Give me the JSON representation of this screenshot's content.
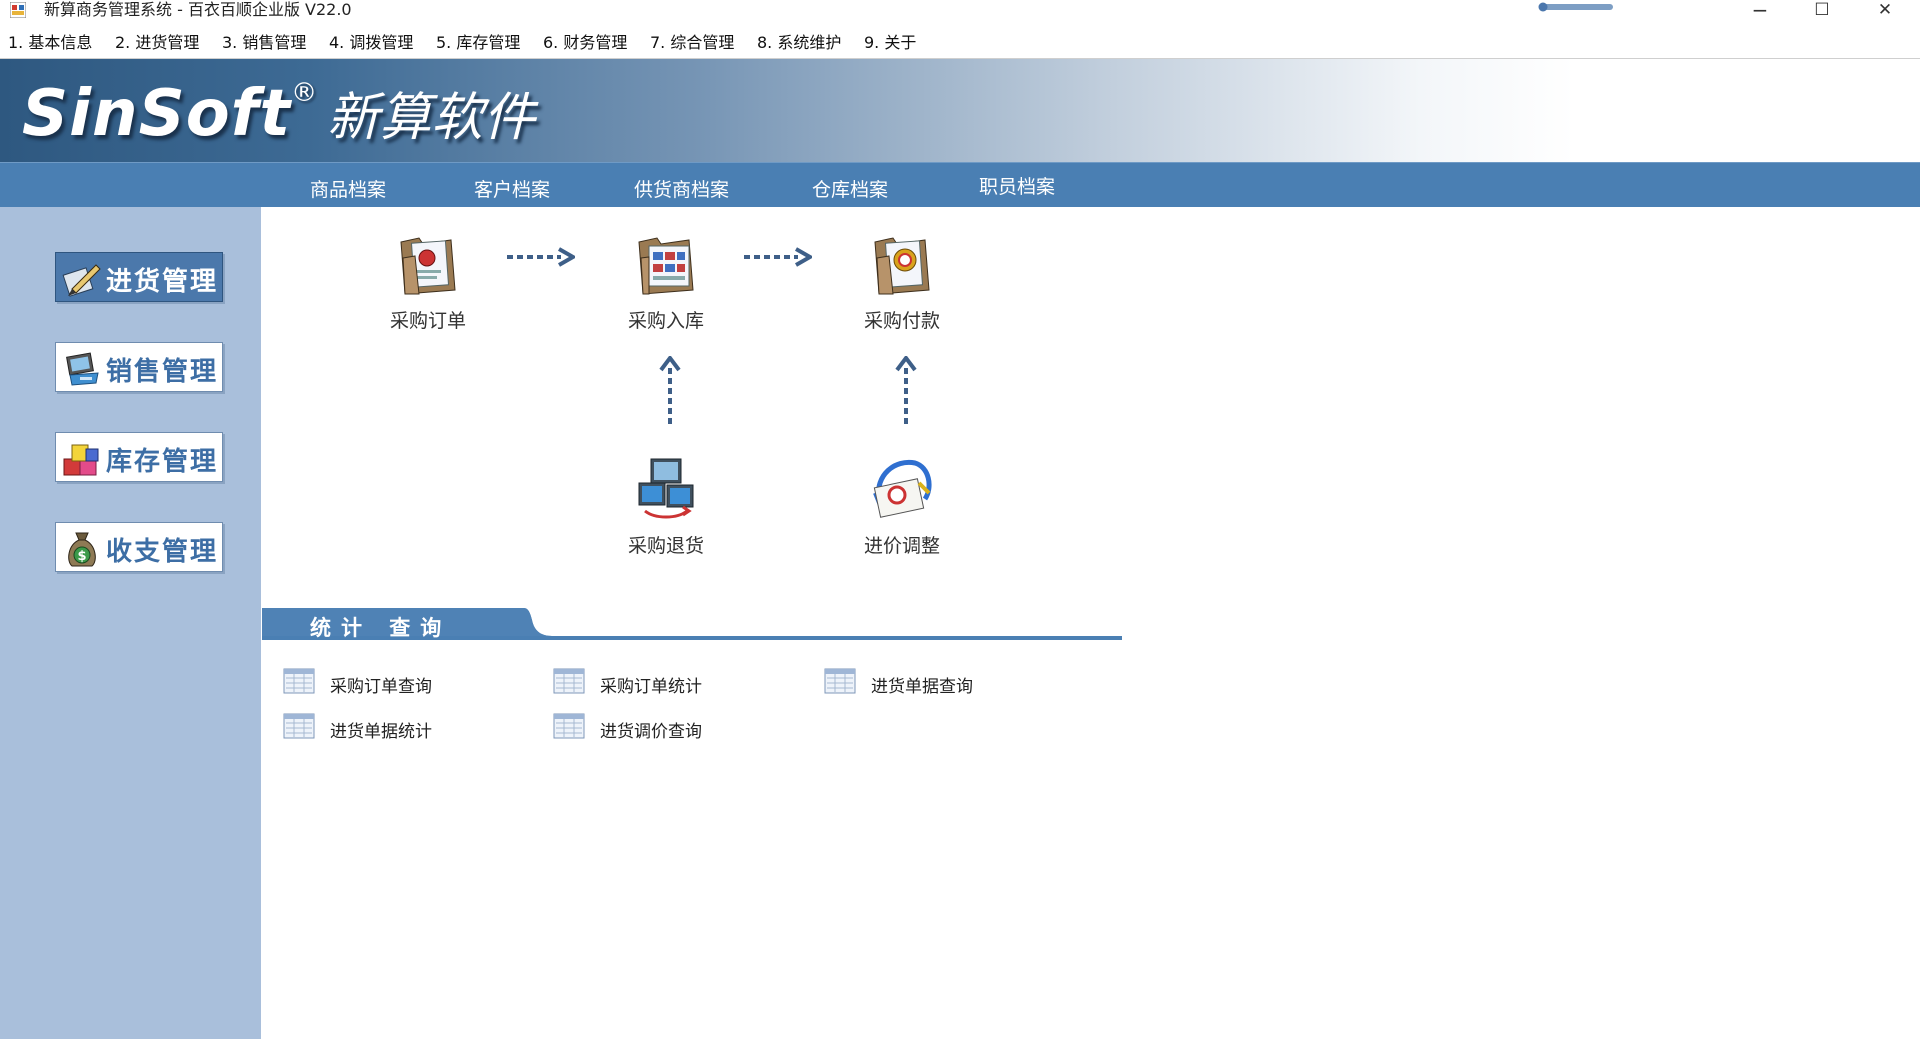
{
  "window": {
    "title": "新算商务管理系统 - 百衣百顺企业版 V22.0",
    "minimize_glyph": "−",
    "maximize_glyph": "☐",
    "close_glyph": "✕"
  },
  "menu": [
    {
      "label": "1. 基本信息"
    },
    {
      "label": "2. 进货管理"
    },
    {
      "label": "3. 销售管理"
    },
    {
      "label": "4. 调拨管理"
    },
    {
      "label": "5. 库存管理"
    },
    {
      "label": "6. 财务管理"
    },
    {
      "label": "7. 综合管理"
    },
    {
      "label": "8. 系统维护"
    },
    {
      "label": "9. 关于"
    }
  ],
  "banner": {
    "logo_en": "SinSoft",
    "logo_reg": "®",
    "logo_cn": "新算软件"
  },
  "nav": [
    {
      "label": "商品档案"
    },
    {
      "label": "客户档案"
    },
    {
      "label": "供货商档案"
    },
    {
      "label": "仓库档案"
    },
    {
      "label": "职员档案"
    }
  ],
  "sidebar": [
    {
      "label": "进货管理",
      "icon": "purchase-pen-icon",
      "active": true
    },
    {
      "label": "销售管理",
      "icon": "sales-pos-icon",
      "active": false
    },
    {
      "label": "库存管理",
      "icon": "inventory-cubes-icon",
      "active": false
    },
    {
      "label": "收支管理",
      "icon": "money-bag-icon",
      "active": false
    }
  ],
  "workflow": {
    "nodes": [
      {
        "label": "采购订单",
        "icon": "purchase-order-folder-icon"
      },
      {
        "label": "采购入库",
        "icon": "purchase-receipt-folder-icon"
      },
      {
        "label": "采购付款",
        "icon": "purchase-payment-folder-icon"
      },
      {
        "label": "采购退货",
        "icon": "purchase-return-icon"
      },
      {
        "label": "进价调整",
        "icon": "price-adjust-icon"
      }
    ]
  },
  "stats": {
    "title": "统计 查询",
    "links": [
      {
        "label": "采购订单查询"
      },
      {
        "label": "采购订单统计"
      },
      {
        "label": "进货单据查询"
      },
      {
        "label": "进货单据统计"
      },
      {
        "label": "进货调价查询"
      }
    ]
  },
  "colors": {
    "nav_bar": "#4a7fb3",
    "sidebar": "#a9bfdb",
    "accent": "#3d6ea5",
    "arrow": "#3e5f88"
  }
}
